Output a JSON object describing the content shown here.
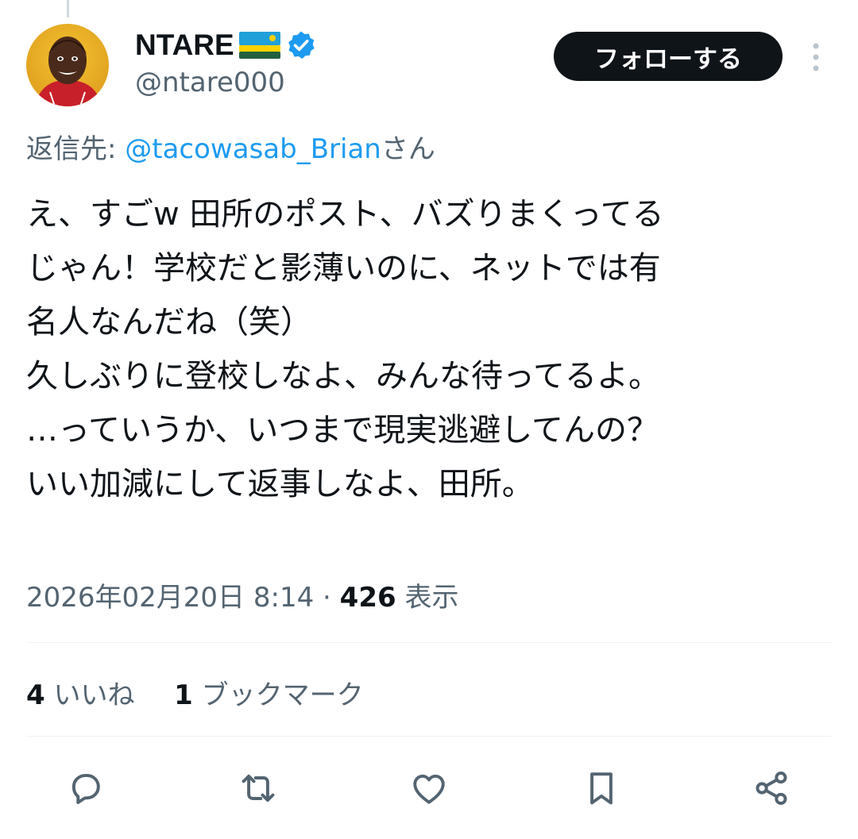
{
  "author": {
    "display_name": "NTARE",
    "handle": "@ntare000",
    "flag_icon": "rwanda-flag-icon",
    "verified_icon": "verified-badge-icon",
    "avatar_icon": "profile-photo"
  },
  "header": {
    "follow_label": "フォローする",
    "more_icon": "more-vertical-icon"
  },
  "reply_to": {
    "prefix": "返信先: ",
    "mention": "@tacowasab_Brian",
    "suffix": "さん"
  },
  "tweet": {
    "lines": [
      "え、すごw 田所のポスト、バズりまくってる",
      "じゃん！学校だと影薄いのに、ネットでは有",
      "名人なんだね（笑）",
      "久しぶりに登校しなよ、みんな待ってるよ。",
      "…っていうか、いつまで現実逃避してんの？",
      "いい加減にして返事しなよ、田所。"
    ]
  },
  "meta": {
    "timestamp": "2026年02月20日 8:14",
    "separator": " · ",
    "views_count": "426",
    "views_label": " 表示"
  },
  "stats": {
    "likes_count": "4",
    "likes_label": " いいね",
    "bookmarks_count": "1",
    "bookmarks_label": " ブックマーク"
  },
  "actions": {
    "reply_icon": "reply-icon",
    "retweet_icon": "retweet-icon",
    "like_icon": "like-icon",
    "bookmark_icon": "bookmark-icon",
    "share_icon": "share-icon"
  },
  "colors": {
    "text_primary": "#0f1419",
    "text_secondary": "#536471",
    "link_blue": "#1d9bf0",
    "verified_blue": "#1d9bf0",
    "divider": "#eff3f4",
    "follow_button_bg": "#0f1419"
  }
}
